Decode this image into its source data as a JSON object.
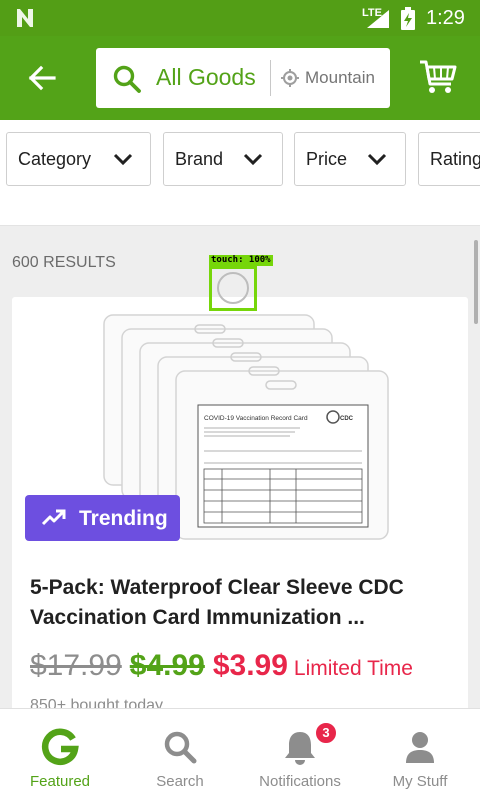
{
  "status_bar": {
    "network": "LTE",
    "time": "1:29"
  },
  "search": {
    "query": "All Goods",
    "location": "Mountain"
  },
  "filters": [
    {
      "label": "Category"
    },
    {
      "label": "Brand"
    },
    {
      "label": "Price"
    },
    {
      "label": "Rating"
    }
  ],
  "results": {
    "count_label": "600 RESULTS"
  },
  "touch_overlay": {
    "label": "touch: 100%"
  },
  "product": {
    "badge": "Trending",
    "title": "5-Pack: Waterproof Clear Sleeve CDC Vaccination Card Immunization ...",
    "original_price": "$17.99",
    "previous_price": "$4.99",
    "current_price": "$3.99",
    "price_note": "Limited Time",
    "bought_text": "850+ bought today",
    "image_caption": "COVID-19 Vaccination Record Card"
  },
  "bottom_nav": {
    "featured": "Featured",
    "search": "Search",
    "notifications": "Notifications",
    "notifications_count": "3",
    "my_stuff": "My Stuff"
  },
  "colors": {
    "brand_green": "#53a318",
    "trending_purple": "#6d4fe0",
    "sale_red": "#e8264a"
  }
}
